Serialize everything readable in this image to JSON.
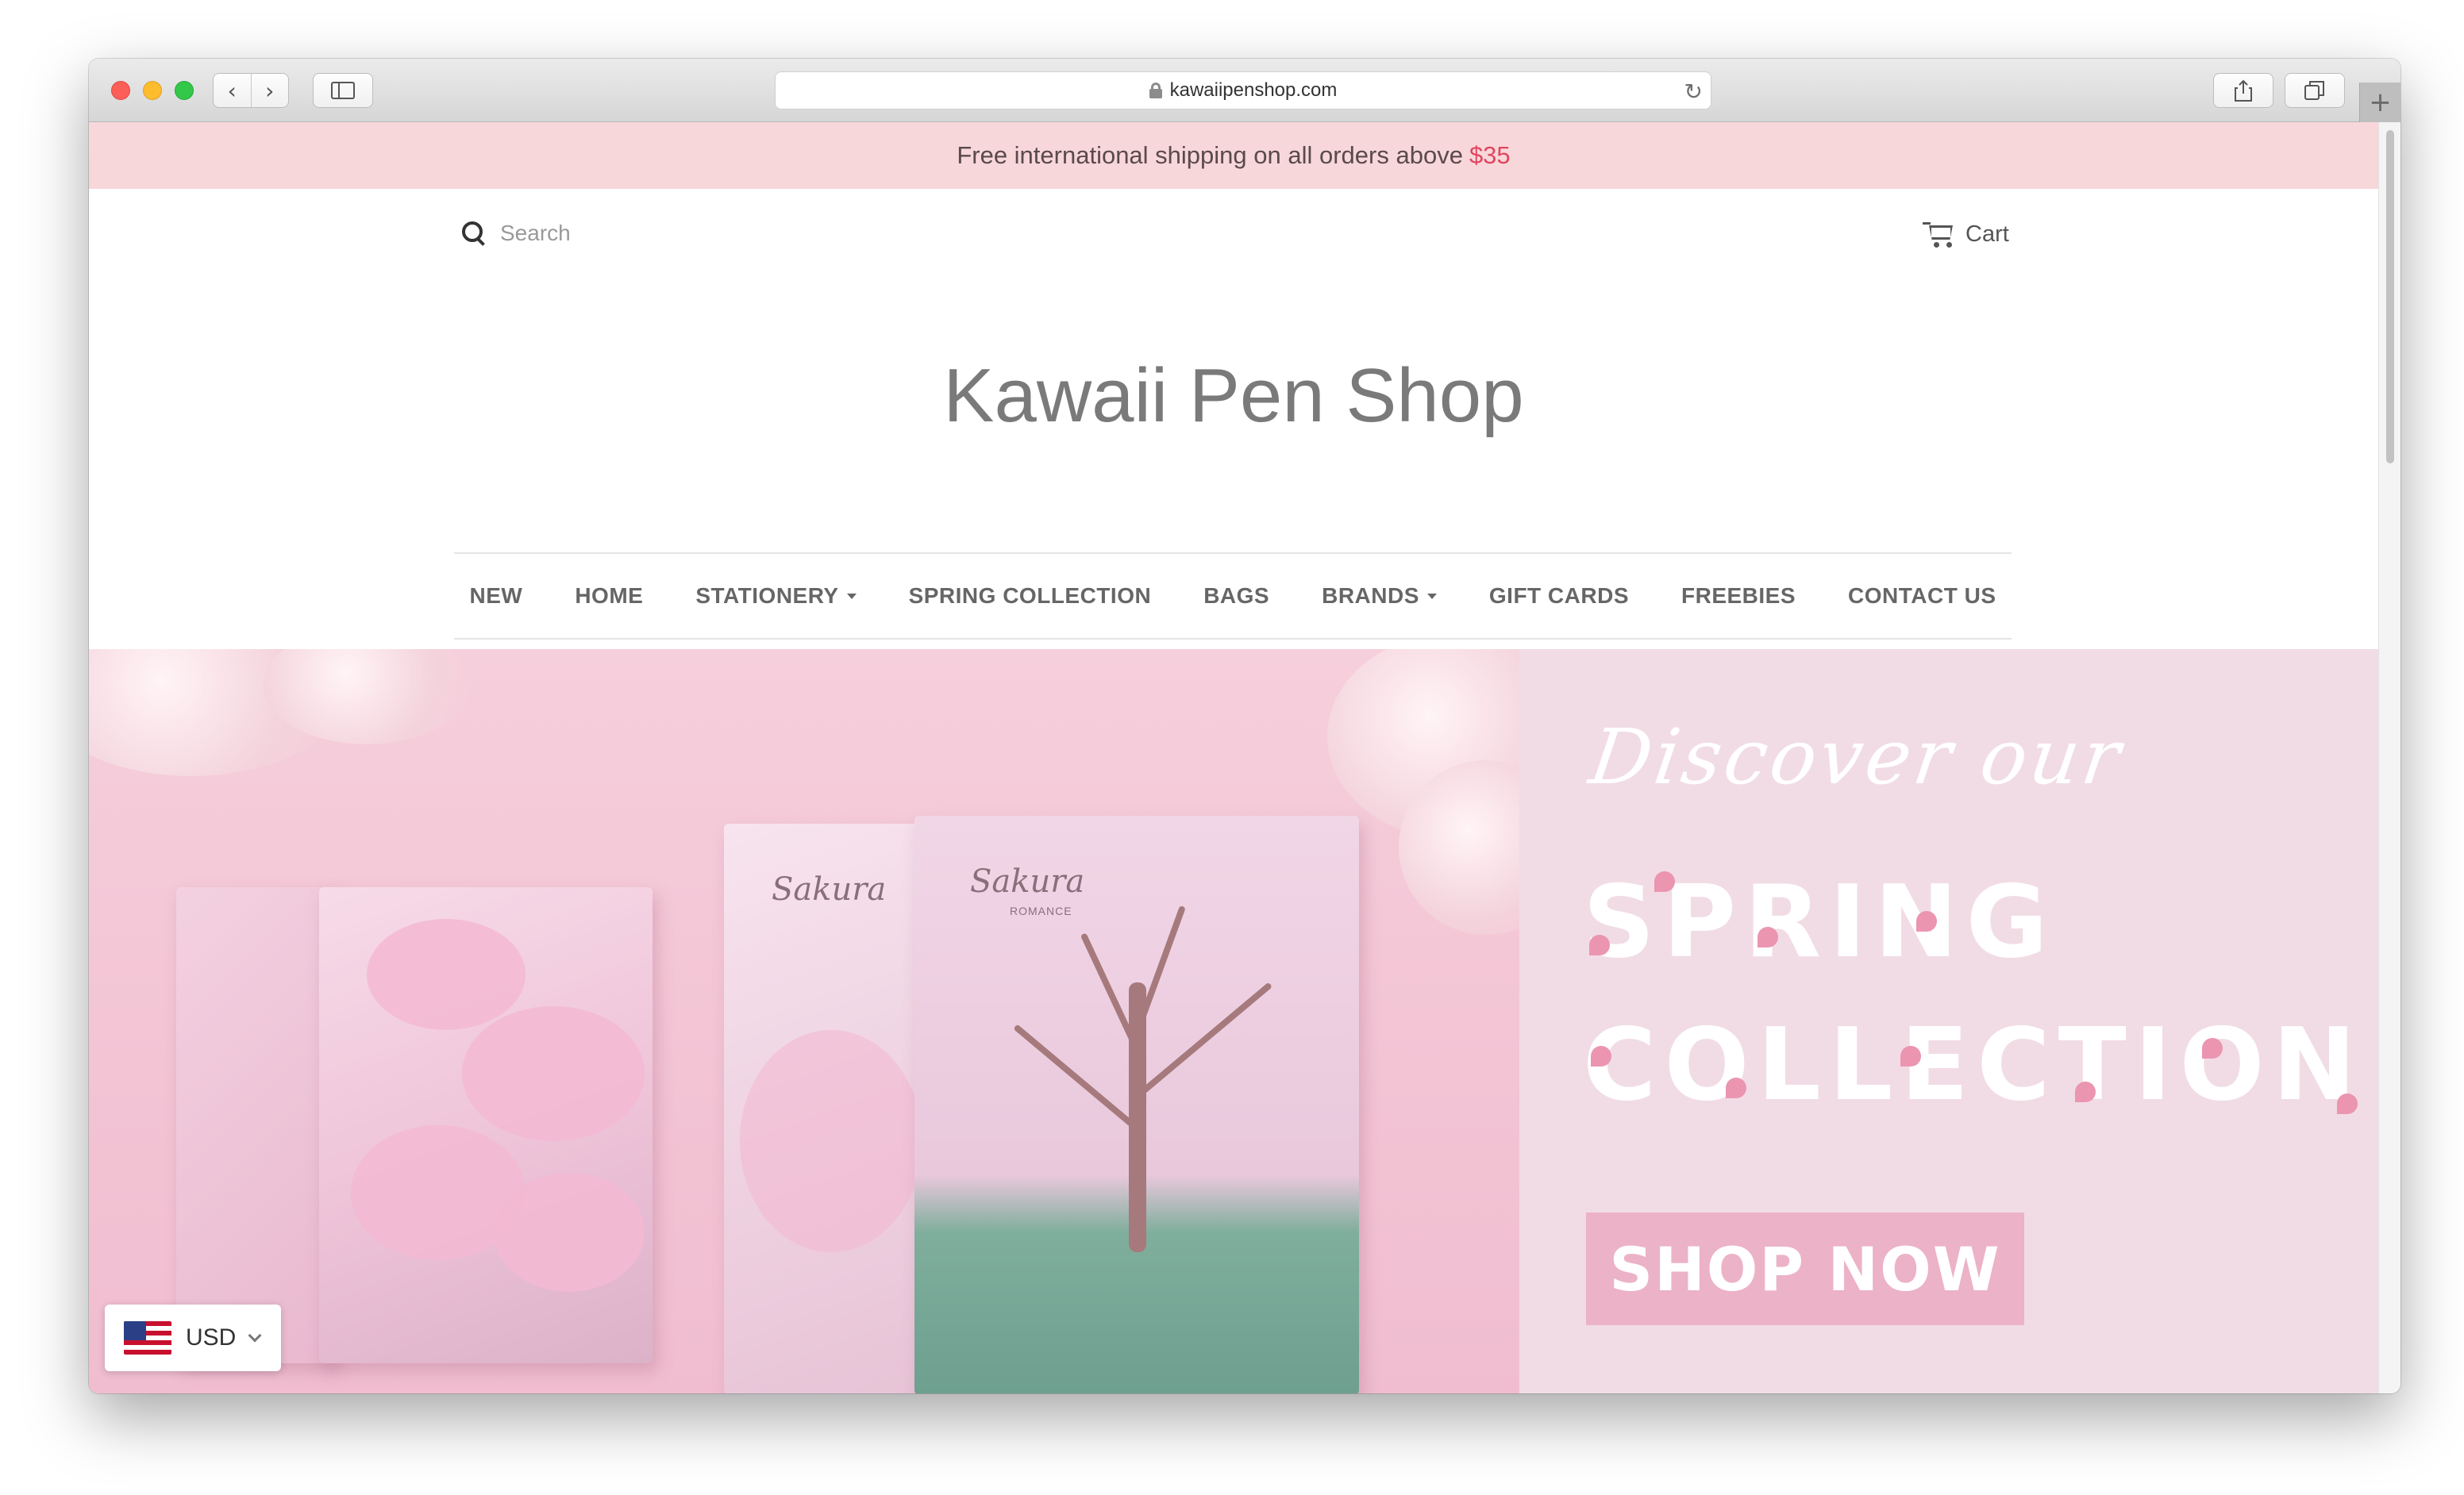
{
  "browser": {
    "url": "kawaiipenshop.com",
    "back_icon": "‹",
    "forward_icon": "›",
    "reload_icon": "↻",
    "new_tab_icon": "+"
  },
  "announcement": {
    "text": "Free international shipping on all orders above",
    "price": "$35"
  },
  "header": {
    "search_placeholder": "Search",
    "cart_label": "Cart",
    "site_title": "Kawaii Pen Shop"
  },
  "nav": {
    "items": [
      {
        "label": "NEW",
        "dropdown": false
      },
      {
        "label": "HOME",
        "dropdown": false
      },
      {
        "label": "STATIONERY",
        "dropdown": true
      },
      {
        "label": "SPRING COLLECTION",
        "dropdown": false
      },
      {
        "label": "BAGS",
        "dropdown": false
      },
      {
        "label": "BRANDS",
        "dropdown": true
      },
      {
        "label": "GIFT CARDS",
        "dropdown": false
      },
      {
        "label": "FREEBIES",
        "dropdown": false
      },
      {
        "label": "CONTACT US",
        "dropdown": false
      }
    ]
  },
  "hero": {
    "discover": "Discover our",
    "line1": "SPRING",
    "line2": "COLLECTION",
    "cta": "SHOP NOW",
    "book_script": "Sakura",
    "book_sub": "ROMANCE"
  },
  "currency": {
    "code": "USD"
  },
  "colors": {
    "announcement_bg": "#f8d7da",
    "price_accent": "#e0465f",
    "hero_panel_bg": "#f1dce5",
    "cta_bg": "#ecb2c7"
  }
}
